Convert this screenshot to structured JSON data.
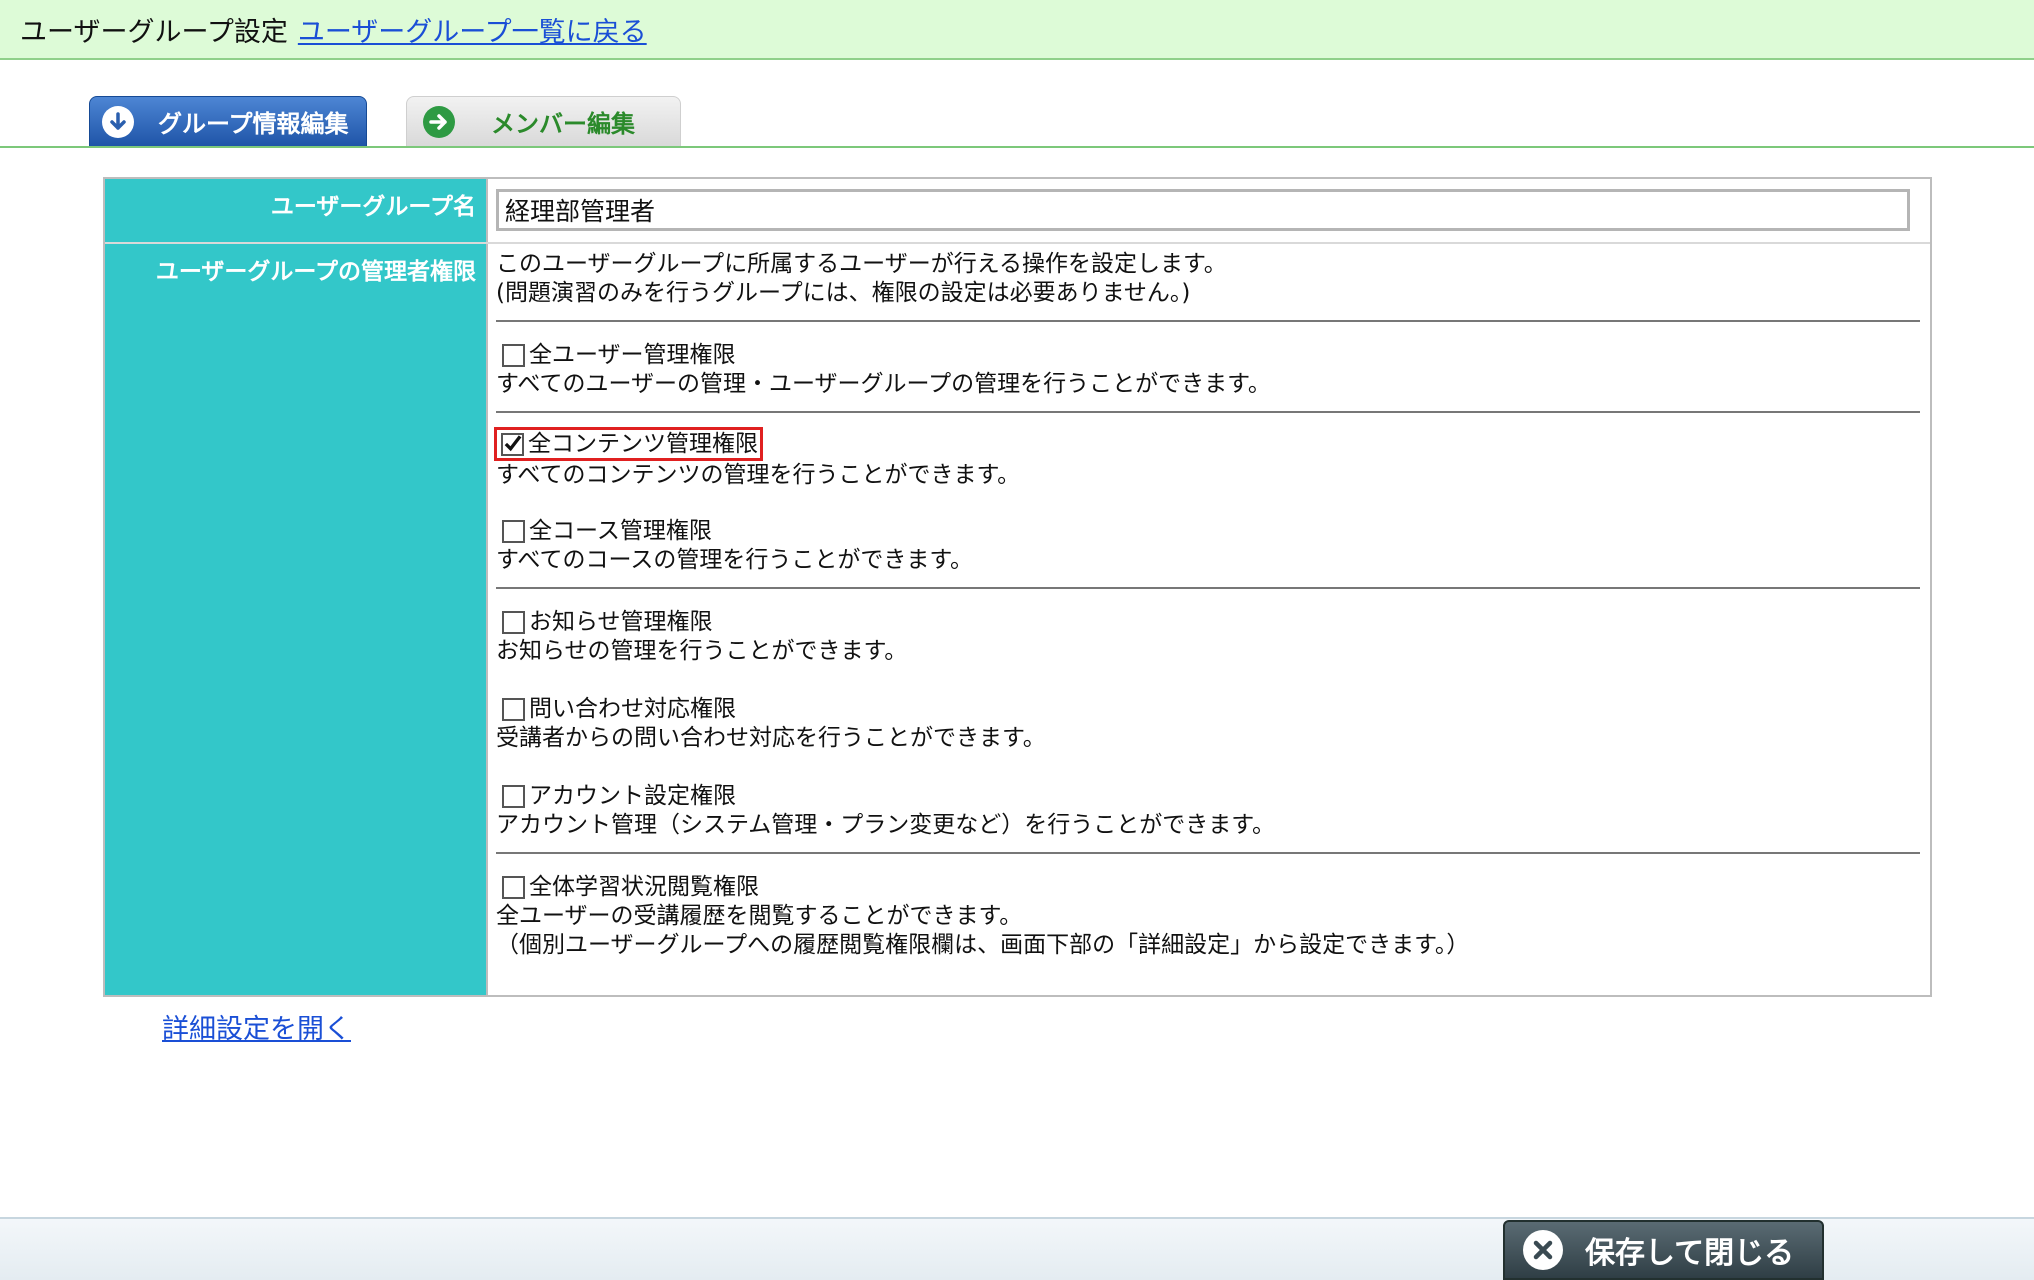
{
  "header": {
    "title": "ユーザーグループ設定",
    "back_link": "ユーザーグループ一覧に戻る"
  },
  "tabs": [
    {
      "label": "グループ情報編集",
      "active": true,
      "icon": "arrow-down-circle-icon"
    },
    {
      "label": "メンバー編集",
      "active": false,
      "icon": "arrow-right-circle-icon"
    }
  ],
  "form": {
    "name_label": "ユーザーグループ名",
    "name_value": "経理部管理者",
    "permissions_label": "ユーザーグループの管理者権限",
    "intro_line1": "このユーザーグループに所属するユーザーが行える操作を設定します。",
    "intro_line2": "(問題演習のみを行うグループには、権限の設定は必要ありません。)",
    "permissions": [
      {
        "label": "全ユーザー管理権限",
        "desc": "すべてのユーザーの管理・ユーザーグループの管理を行うことができます。",
        "checked": false
      },
      {
        "label": "全コンテンツ管理権限",
        "desc": "すべてのコンテンツの管理を行うことができます。",
        "checked": true
      },
      {
        "label": "全コース管理権限",
        "desc": "すべてのコースの管理を行うことができます。",
        "checked": false
      },
      {
        "label": "お知らせ管理権限",
        "desc": "お知らせの管理を行うことができます。",
        "checked": false
      },
      {
        "label": "問い合わせ対応権限",
        "desc": "受講者からの問い合わせ対応を行うことができます。",
        "checked": false
      },
      {
        "label": "アカウント設定権限",
        "desc": "アカウント管理（システム管理・プラン変更など）を行うことができます。",
        "checked": false
      },
      {
        "label": "全体学習状況閲覧権限",
        "desc": "全ユーザーの受講履歴を閲覧することができます。",
        "desc2": "（個別ユーザーグループへの履歴閲覧権限欄は、画面下部の「詳細設定」から設定できます。）",
        "checked": false
      }
    ]
  },
  "detail_link": "詳細設定を開く",
  "footer": {
    "save_close": "保存して閉じる"
  },
  "colors": {
    "header_bg": "#ddfbd7",
    "label_col_bg": "#33c7c9",
    "link": "#1a4fd6",
    "highlight": "#e02020"
  }
}
